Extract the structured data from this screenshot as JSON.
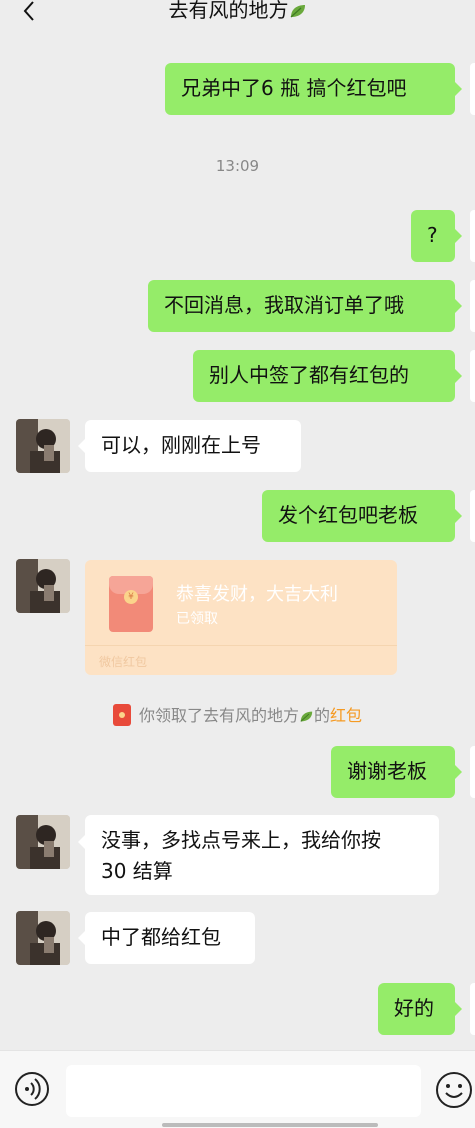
{
  "header": {
    "title": "去有风的地方",
    "back_icon": "chevron-left-icon",
    "title_emoji": "leaf-icon"
  },
  "messages": [
    {
      "side": "out",
      "text": "兄弟中了6 瓶 搞个红包吧"
    },
    {
      "timestamp": "13:09"
    },
    {
      "side": "out",
      "text": "?"
    },
    {
      "side": "out",
      "text": "不回消息，我取消订单了哦"
    },
    {
      "side": "out",
      "text": "别人中签了都有红包的"
    },
    {
      "side": "in",
      "text": "可以，刚刚在上号"
    },
    {
      "side": "out",
      "text": "发个红包吧老板"
    },
    {
      "side": "in",
      "type": "red_packet",
      "title": "恭喜发财，大吉大利",
      "status": "已领取",
      "brand": "微信红包"
    },
    {
      "system": true,
      "prefix": "你领取了",
      "sender": "去有风的地方",
      "middle": "的",
      "link": "红包"
    },
    {
      "side": "out",
      "text": "谢谢老板"
    },
    {
      "side": "in",
      "lines": [
        "没事，多找点号来上，我给你按",
        "30 结算"
      ]
    },
    {
      "side": "in",
      "text": "中了都给红包"
    },
    {
      "side": "out",
      "text": "好的"
    }
  ],
  "footer": {
    "voice_icon": "voice-icon",
    "emoji_icon": "emoji-icon"
  },
  "colors": {
    "outgoing_bubble": "#95ec69",
    "incoming_bubble": "#ffffff",
    "background": "#ededed",
    "red_packet": "#fde2c4",
    "link": "#f59a23"
  }
}
